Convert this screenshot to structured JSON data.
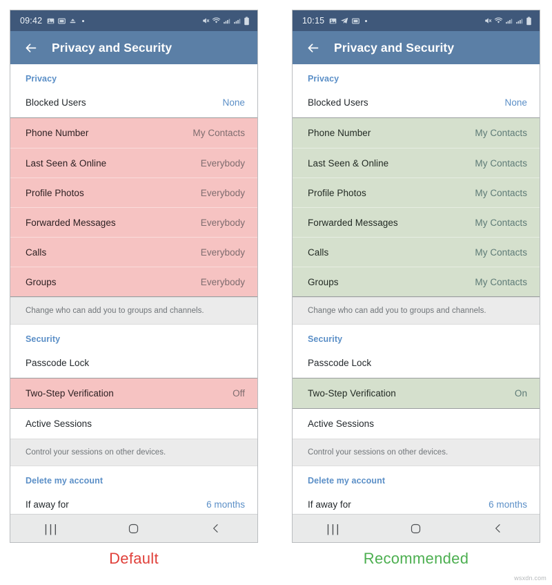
{
  "colors": {
    "statusbar_bg": "#3f587a",
    "appbar_bg": "#5b7fa6",
    "bad_highlight": "#f6c3c2",
    "good_highlight": "#d5e0cd",
    "link_blue": "#5b8fc7",
    "caption_red": "#e0403a",
    "caption_green": "#4caf50"
  },
  "panels": [
    {
      "id": "default",
      "caption": "Default",
      "status": {
        "time": "09:42",
        "icons": [
          "image-icon",
          "screenshot-icon",
          "upload-icon",
          "dot-icon"
        ],
        "right_icons": [
          "mute-icon",
          "wifi-icon",
          "signal-icon",
          "signal-icon",
          "battery-icon"
        ]
      },
      "appbar": {
        "back_label": "Back",
        "title": "Privacy and Security"
      },
      "privacy_section_title": "Privacy",
      "top_rows": [
        {
          "label": "Blocked Users",
          "value": "None"
        }
      ],
      "highlight_rows": [
        {
          "label": "Phone Number",
          "value": "My Contacts"
        },
        {
          "label": "Last Seen & Online",
          "value": "Everybody"
        },
        {
          "label": "Profile Photos",
          "value": "Everybody"
        },
        {
          "label": "Forwarded Messages",
          "value": "Everybody"
        },
        {
          "label": "Calls",
          "value": "Everybody"
        },
        {
          "label": "Groups",
          "value": "Everybody"
        }
      ],
      "groups_note": "Change who can add you to groups and channels.",
      "security_section_title": "Security",
      "passcode_row": {
        "label": "Passcode Lock",
        "value": ""
      },
      "twostep_row": {
        "label": "Two-Step Verification",
        "value": "Off"
      },
      "sessions_row": {
        "label": "Active Sessions",
        "value": ""
      },
      "sessions_note": "Control your sessions on other devices.",
      "delete_section_title": "Delete my account",
      "away_row": {
        "label": "If away for",
        "value": "6 months"
      },
      "nav": {
        "recents": "|||",
        "home": "home-icon",
        "back": "back-chevron-icon"
      }
    },
    {
      "id": "recommended",
      "caption": "Recommended",
      "status": {
        "time": "10:15",
        "icons": [
          "image-icon",
          "telegram-icon",
          "screenshot-icon",
          "dot-icon"
        ],
        "right_icons": [
          "mute-icon",
          "wifi-icon",
          "signal-icon",
          "signal-icon",
          "battery-icon"
        ]
      },
      "appbar": {
        "back_label": "Back",
        "title": "Privacy and Security"
      },
      "privacy_section_title": "Privacy",
      "top_rows": [
        {
          "label": "Blocked Users",
          "value": "None"
        }
      ],
      "highlight_rows": [
        {
          "label": "Phone Number",
          "value": "My Contacts"
        },
        {
          "label": "Last Seen & Online",
          "value": "My Contacts"
        },
        {
          "label": "Profile Photos",
          "value": "My Contacts"
        },
        {
          "label": "Forwarded Messages",
          "value": "My Contacts"
        },
        {
          "label": "Calls",
          "value": "My Contacts"
        },
        {
          "label": "Groups",
          "value": "My Contacts"
        }
      ],
      "groups_note": "Change who can add you to groups and channels.",
      "security_section_title": "Security",
      "passcode_row": {
        "label": "Passcode Lock",
        "value": ""
      },
      "twostep_row": {
        "label": "Two-Step Verification",
        "value": "On"
      },
      "sessions_row": {
        "label": "Active Sessions",
        "value": ""
      },
      "sessions_note": "Control your sessions on other devices.",
      "delete_section_title": "Delete my account",
      "away_row": {
        "label": "If away for",
        "value": "6 months"
      },
      "nav": {
        "recents": "|||",
        "home": "home-icon",
        "back": "back-chevron-icon"
      }
    }
  ],
  "watermark": "wsxdn.com"
}
